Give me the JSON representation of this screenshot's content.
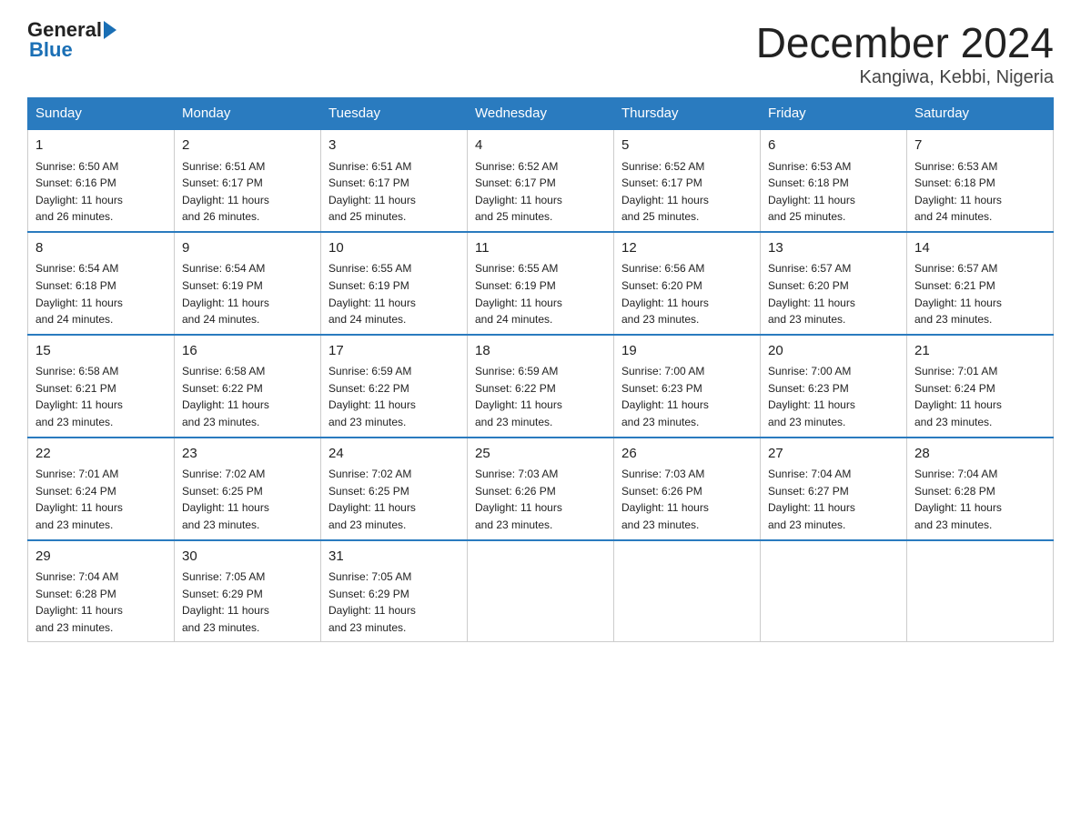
{
  "header": {
    "logo_general": "General",
    "logo_blue": "Blue",
    "month_year": "December 2024",
    "location": "Kangiwa, Kebbi, Nigeria"
  },
  "days_of_week": [
    "Sunday",
    "Monday",
    "Tuesday",
    "Wednesday",
    "Thursday",
    "Friday",
    "Saturday"
  ],
  "weeks": [
    [
      {
        "day": "1",
        "sunrise": "6:50 AM",
        "sunset": "6:16 PM",
        "daylight": "11 hours and 26 minutes."
      },
      {
        "day": "2",
        "sunrise": "6:51 AM",
        "sunset": "6:17 PM",
        "daylight": "11 hours and 26 minutes."
      },
      {
        "day": "3",
        "sunrise": "6:51 AM",
        "sunset": "6:17 PM",
        "daylight": "11 hours and 25 minutes."
      },
      {
        "day": "4",
        "sunrise": "6:52 AM",
        "sunset": "6:17 PM",
        "daylight": "11 hours and 25 minutes."
      },
      {
        "day": "5",
        "sunrise": "6:52 AM",
        "sunset": "6:17 PM",
        "daylight": "11 hours and 25 minutes."
      },
      {
        "day": "6",
        "sunrise": "6:53 AM",
        "sunset": "6:18 PM",
        "daylight": "11 hours and 25 minutes."
      },
      {
        "day": "7",
        "sunrise": "6:53 AM",
        "sunset": "6:18 PM",
        "daylight": "11 hours and 24 minutes."
      }
    ],
    [
      {
        "day": "8",
        "sunrise": "6:54 AM",
        "sunset": "6:18 PM",
        "daylight": "11 hours and 24 minutes."
      },
      {
        "day": "9",
        "sunrise": "6:54 AM",
        "sunset": "6:19 PM",
        "daylight": "11 hours and 24 minutes."
      },
      {
        "day": "10",
        "sunrise": "6:55 AM",
        "sunset": "6:19 PM",
        "daylight": "11 hours and 24 minutes."
      },
      {
        "day": "11",
        "sunrise": "6:55 AM",
        "sunset": "6:19 PM",
        "daylight": "11 hours and 24 minutes."
      },
      {
        "day": "12",
        "sunrise": "6:56 AM",
        "sunset": "6:20 PM",
        "daylight": "11 hours and 23 minutes."
      },
      {
        "day": "13",
        "sunrise": "6:57 AM",
        "sunset": "6:20 PM",
        "daylight": "11 hours and 23 minutes."
      },
      {
        "day": "14",
        "sunrise": "6:57 AM",
        "sunset": "6:21 PM",
        "daylight": "11 hours and 23 minutes."
      }
    ],
    [
      {
        "day": "15",
        "sunrise": "6:58 AM",
        "sunset": "6:21 PM",
        "daylight": "11 hours and 23 minutes."
      },
      {
        "day": "16",
        "sunrise": "6:58 AM",
        "sunset": "6:22 PM",
        "daylight": "11 hours and 23 minutes."
      },
      {
        "day": "17",
        "sunrise": "6:59 AM",
        "sunset": "6:22 PM",
        "daylight": "11 hours and 23 minutes."
      },
      {
        "day": "18",
        "sunrise": "6:59 AM",
        "sunset": "6:22 PM",
        "daylight": "11 hours and 23 minutes."
      },
      {
        "day": "19",
        "sunrise": "7:00 AM",
        "sunset": "6:23 PM",
        "daylight": "11 hours and 23 minutes."
      },
      {
        "day": "20",
        "sunrise": "7:00 AM",
        "sunset": "6:23 PM",
        "daylight": "11 hours and 23 minutes."
      },
      {
        "day": "21",
        "sunrise": "7:01 AM",
        "sunset": "6:24 PM",
        "daylight": "11 hours and 23 minutes."
      }
    ],
    [
      {
        "day": "22",
        "sunrise": "7:01 AM",
        "sunset": "6:24 PM",
        "daylight": "11 hours and 23 minutes."
      },
      {
        "day": "23",
        "sunrise": "7:02 AM",
        "sunset": "6:25 PM",
        "daylight": "11 hours and 23 minutes."
      },
      {
        "day": "24",
        "sunrise": "7:02 AM",
        "sunset": "6:25 PM",
        "daylight": "11 hours and 23 minutes."
      },
      {
        "day": "25",
        "sunrise": "7:03 AM",
        "sunset": "6:26 PM",
        "daylight": "11 hours and 23 minutes."
      },
      {
        "day": "26",
        "sunrise": "7:03 AM",
        "sunset": "6:26 PM",
        "daylight": "11 hours and 23 minutes."
      },
      {
        "day": "27",
        "sunrise": "7:04 AM",
        "sunset": "6:27 PM",
        "daylight": "11 hours and 23 minutes."
      },
      {
        "day": "28",
        "sunrise": "7:04 AM",
        "sunset": "6:28 PM",
        "daylight": "11 hours and 23 minutes."
      }
    ],
    [
      {
        "day": "29",
        "sunrise": "7:04 AM",
        "sunset": "6:28 PM",
        "daylight": "11 hours and 23 minutes."
      },
      {
        "day": "30",
        "sunrise": "7:05 AM",
        "sunset": "6:29 PM",
        "daylight": "11 hours and 23 minutes."
      },
      {
        "day": "31",
        "sunrise": "7:05 AM",
        "sunset": "6:29 PM",
        "daylight": "11 hours and 23 minutes."
      },
      null,
      null,
      null,
      null
    ]
  ],
  "labels": {
    "sunrise": "Sunrise:",
    "sunset": "Sunset:",
    "daylight": "Daylight:"
  }
}
